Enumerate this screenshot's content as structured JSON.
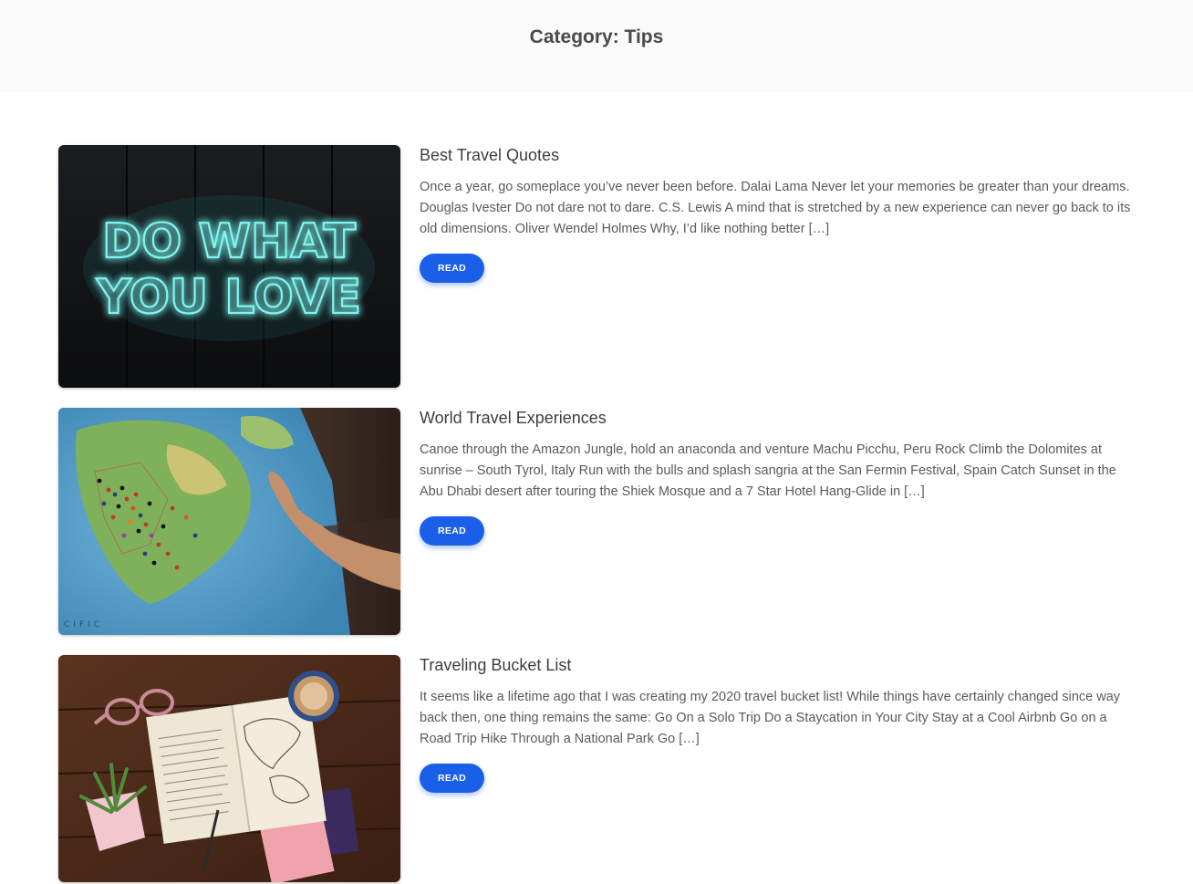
{
  "header": {
    "title": "Category: Tips"
  },
  "posts": [
    {
      "title": "Best Travel Quotes",
      "excerpt": "Once a year, go someplace you’ve never been before. Dalai Lama Never let your memories be greater than your dreams. Douglas Ivester Do not dare not to dare. C.S. Lewis A mind that is stretched by a new experience can never go back to its old dimensions. Oliver Wendel Holmes Why, I’d like nothing better […]",
      "button_label": "READ",
      "image": {
        "name": "neon-sign-image",
        "text_line1": "DO WHAT",
        "text_line2": "YOU LOVE"
      }
    },
    {
      "title": "World Travel Experiences",
      "excerpt": "Canoe through the Amazon Jungle, hold an anaconda and venture Machu Picchu, Peru Rock Climb the Dolomites at sunrise – South Tyrol, Italy Run with the bulls and splash sangria at the San Fermin Festival, Spain Catch Sunset in the Abu Dhabi desert after touring the Shiek Mosque and a 7 Star Hotel Hang-Glide in […]",
      "button_label": "READ",
      "image": {
        "name": "world-map-pins-image"
      }
    },
    {
      "title": "Traveling Bucket List",
      "excerpt": "It seems like a lifetime ago that I was creating my 2020 travel bucket list! While things have certainly changed since way back then, one thing remains the same: Go On a Solo Trip Do a Staycation in Your City Stay at a Cool Airbnb Go on a Road Trip Hike Through a National Park Go […]",
      "button_label": "READ",
      "image": {
        "name": "travel-journal-desk-image"
      }
    }
  ],
  "colors": {
    "accent": "#1a5fe8",
    "header_bg": "#fafafa",
    "neon": "#3fe3dc"
  }
}
